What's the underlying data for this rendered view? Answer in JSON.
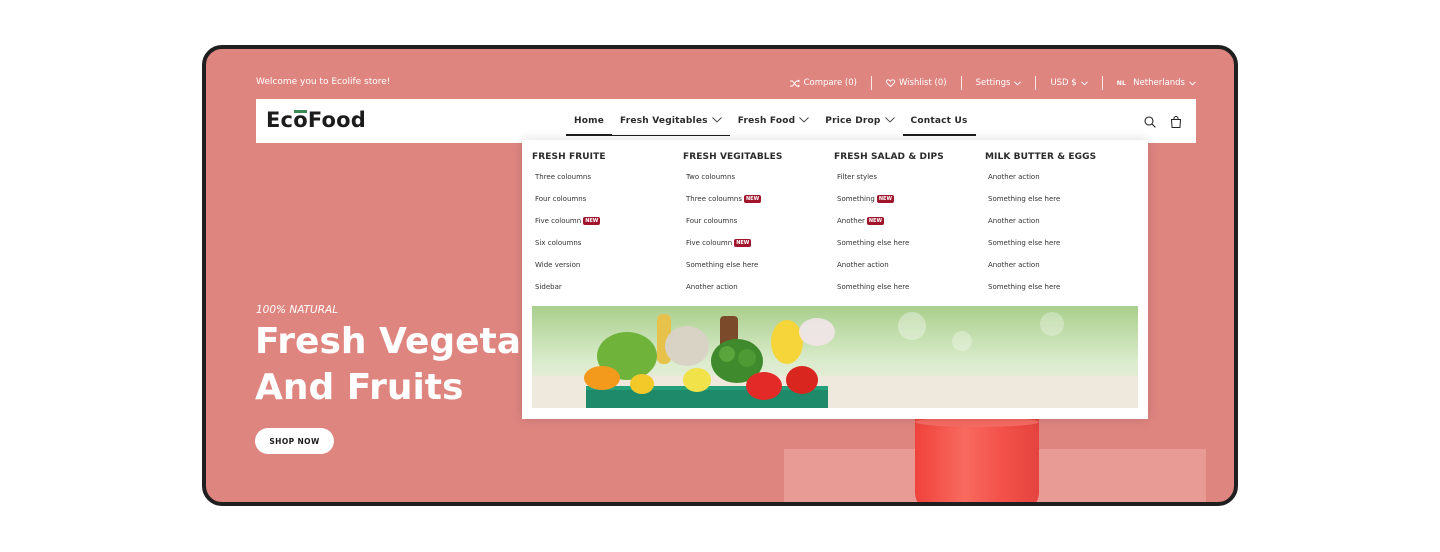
{
  "topbar": {
    "welcome": "Welcome you to Ecolife store!",
    "compare": "Compare (0)",
    "wishlist": "Wishlist (0)",
    "settings": "Settings",
    "currency": "USD $",
    "flag": "NL",
    "language": "Netherlands"
  },
  "logo": {
    "part1": "Ec",
    "part2": "o",
    "part3": "Food"
  },
  "nav": {
    "items": [
      {
        "label": "Home"
      },
      {
        "label": "Fresh Vegitables"
      },
      {
        "label": "Fresh Food"
      },
      {
        "label": "Price Drop"
      },
      {
        "label": "Contact Us"
      }
    ]
  },
  "hero": {
    "tag": "100% NATURAL",
    "title_line1": "Fresh Vegetab",
    "title_line2": "And Fruits",
    "button": "SHOP NOW"
  },
  "mega": {
    "badge": "NEW",
    "columns": [
      {
        "heading": "FRESH FRUITE",
        "links": [
          "Three coloumns",
          "Four coloumns",
          "Five coloumn",
          "Six coloumns",
          "Wide version",
          "Sidebar"
        ]
      },
      {
        "heading": "FRESH VEGITABLES",
        "links": [
          "Two coloumns",
          "Three coloumns",
          "Four coloumns",
          "Five coloumn",
          "Something else here",
          "Another action"
        ]
      },
      {
        "heading": "FRESH SALAD & DIPS",
        "links": [
          "Filter styles",
          "Something",
          "Another",
          "Something else here",
          "Another action",
          "Something else here"
        ]
      },
      {
        "heading": "MILK BUTTER & EGGS",
        "links": [
          "Another action",
          "Something else here",
          "Another action",
          "Something else here",
          "Another action",
          "Something else here"
        ]
      }
    ]
  },
  "colors": {
    "hero_bg": "#df8580",
    "badge": "#a0152c",
    "logo_accent": "#3c8a55"
  }
}
